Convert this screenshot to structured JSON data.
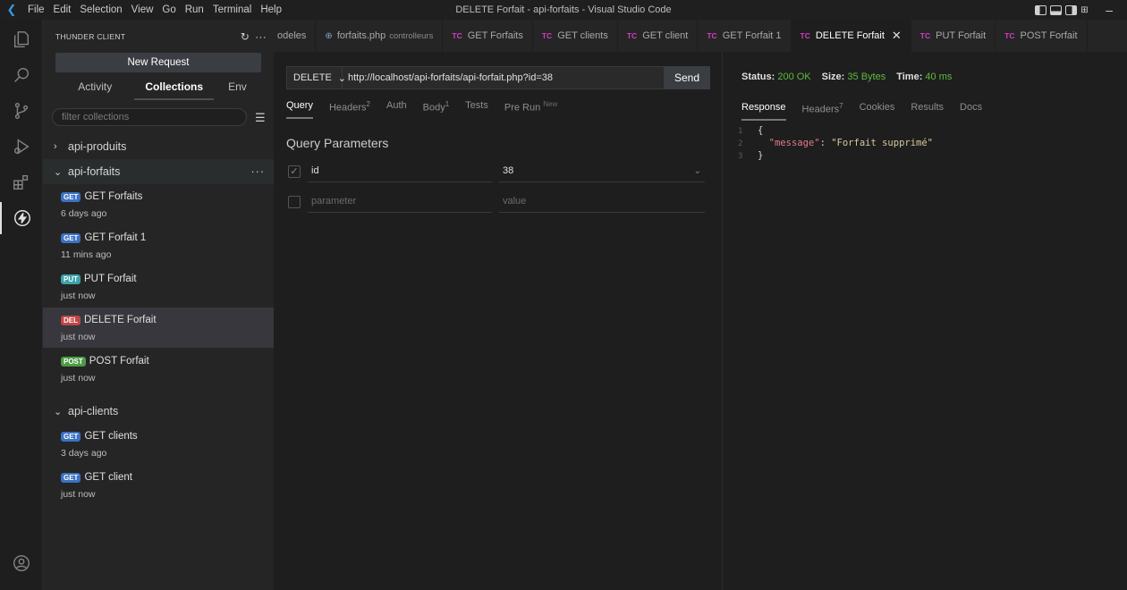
{
  "titlebar": {
    "menu": [
      "File",
      "Edit",
      "Selection",
      "View",
      "Go",
      "Run",
      "Terminal",
      "Help"
    ],
    "window_title": "DELETE Forfait - api-forfaits - Visual Studio Code"
  },
  "sidebar": {
    "header": "THUNDER CLIENT",
    "new_request": "New Request",
    "tabs": [
      "Activity",
      "Collections",
      "Env"
    ],
    "filter_placeholder": "filter collections",
    "collections": [
      {
        "name": "api-produits",
        "expanded": false,
        "chevron": "›",
        "requests": []
      },
      {
        "name": "api-forfaits",
        "expanded": true,
        "chevron": "⌄",
        "requests": [
          {
            "badge": "GET",
            "name": "GET Forfaits",
            "time": "6 days ago"
          },
          {
            "badge": "GET",
            "name": "GET Forfait 1",
            "time": "11 mins ago"
          },
          {
            "badge": "PUT",
            "name": "PUT Forfait",
            "time": "just now"
          },
          {
            "badge": "DEL",
            "name": "DELETE Forfait",
            "time": "just now"
          },
          {
            "badge": "POST",
            "name": "POST Forfait",
            "time": "just now"
          }
        ]
      },
      {
        "name": "api-clients",
        "expanded": true,
        "chevron": "⌄",
        "requests": [
          {
            "badge": "GET",
            "name": "GET clients",
            "time": "3 days ago"
          },
          {
            "badge": "GET",
            "name": "GET client",
            "time": "just now"
          }
        ]
      }
    ]
  },
  "editor_tabs": [
    {
      "label": "odeles",
      "type": "plain"
    },
    {
      "label": "forfaits.php",
      "sub": "controlleurs",
      "type": "php"
    },
    {
      "label": "GET Forfaits",
      "type": "tc"
    },
    {
      "label": "GET clients",
      "type": "tc"
    },
    {
      "label": "GET client",
      "type": "tc"
    },
    {
      "label": "GET Forfait 1",
      "type": "tc"
    },
    {
      "label": "DELETE Forfait",
      "type": "tc",
      "active": true
    },
    {
      "label": "PUT Forfait",
      "type": "tc"
    },
    {
      "label": "POST Forfait",
      "type": "tc"
    }
  ],
  "request": {
    "method": "DELETE",
    "url": "http://localhost/api-forfaits/api-forfait.php?id=38",
    "send": "Send",
    "tabs": {
      "query": "Query",
      "headers": "Headers",
      "headers_count": "2",
      "auth": "Auth",
      "body": "Body",
      "body_count": "1",
      "tests": "Tests",
      "prerun": "Pre Run",
      "new_tag": "New"
    },
    "query_title": "Query Parameters",
    "params": [
      {
        "key": "id",
        "value": "38"
      }
    ],
    "new_param": {
      "key_placeholder": "parameter",
      "value_placeholder": "value"
    }
  },
  "response": {
    "status_label": "Status:",
    "status_value": "200 OK",
    "size_label": "Size:",
    "size_value": "35 Bytes",
    "time_label": "Time:",
    "time_value": "40 ms",
    "tabs": {
      "response": "Response",
      "headers": "Headers",
      "headers_count": "7",
      "cookies": "Cookies",
      "results": "Results",
      "docs": "Docs"
    },
    "body_lines": [
      {
        "n": "1",
        "text": "{"
      },
      {
        "n": "2",
        "key": "\"message\"",
        "value": "\"Forfait supprimé\""
      },
      {
        "n": "3",
        "text": "}"
      }
    ]
  },
  "colors": {
    "accent_green": "#5fb93e",
    "badge_get": "#3b72c2",
    "badge_put": "#3ea3a9",
    "badge_del": "#c24646",
    "badge_post": "#4d9a45",
    "tc_icon": "#d33ec0"
  },
  "icons": {
    "activitybar": [
      "explorer-icon",
      "search-icon",
      "source-control-icon",
      "run-debug-icon",
      "extensions-icon",
      "thunder-client-icon",
      "account-icon"
    ]
  }
}
